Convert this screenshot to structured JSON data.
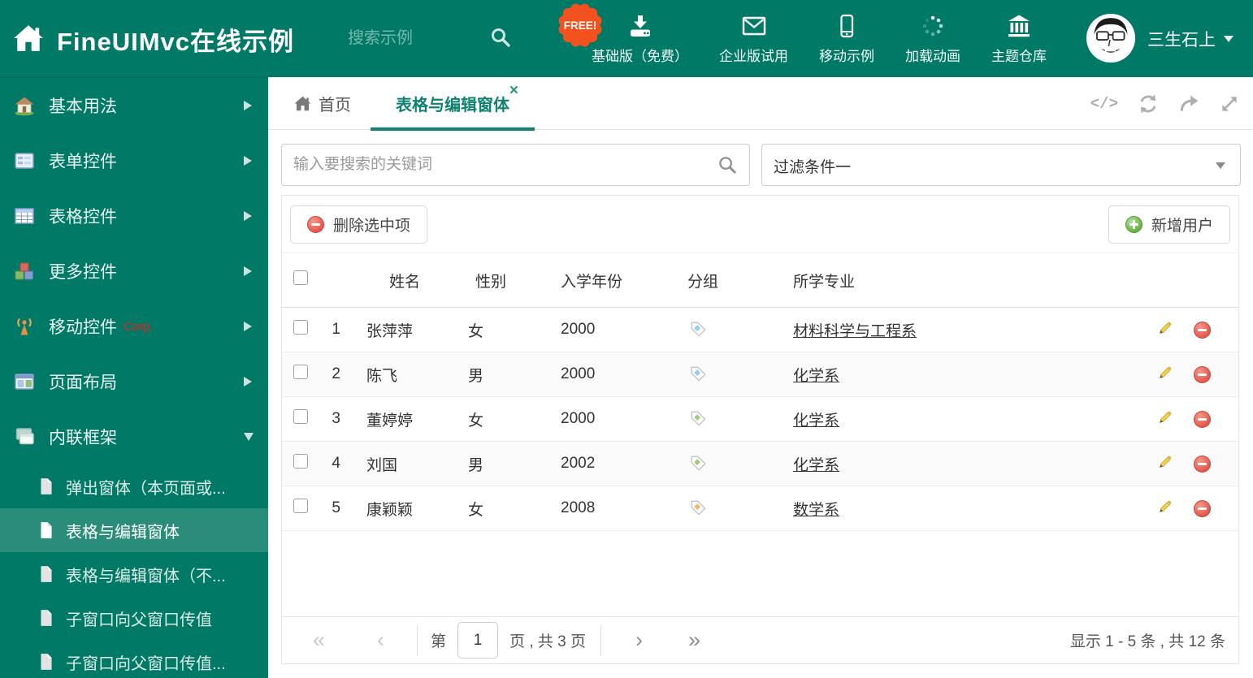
{
  "colors": {
    "brand_teal": "#007a66",
    "sidebar_selected_teal": "#2a8d7a",
    "free_badge_orange": "#f3511d",
    "corp_red": "#f21d1d",
    "active_tab_teal": "#0e8171",
    "tag_blue": "#8ecef2",
    "tag_green": "#9fcc7e",
    "tag_orange": "#f8b26a"
  },
  "header": {
    "title": "FineUIMvc在线示例",
    "search_placeholder": "搜索示例",
    "free_badge": "FREE!",
    "nav": [
      {
        "label": "基础版（免费）",
        "icon": "download-icon"
      },
      {
        "label": "企业版试用",
        "icon": "mail-icon"
      },
      {
        "label": "移动示例",
        "icon": "phone-icon"
      },
      {
        "label": "加载动画",
        "icon": "spinner-icon"
      },
      {
        "label": "主题仓库",
        "icon": "bank-icon"
      }
    ],
    "user": {
      "name": "三生石上"
    }
  },
  "sidebar": {
    "items": [
      {
        "label": "基本用法",
        "icon": "home-icon"
      },
      {
        "label": "表单控件",
        "icon": "form-icon"
      },
      {
        "label": "表格控件",
        "icon": "table-icon"
      },
      {
        "label": "更多控件",
        "icon": "cubes-icon"
      },
      {
        "label": "移动控件",
        "badge": "Corp.",
        "icon": "antenna-icon"
      },
      {
        "label": "页面布局",
        "icon": "layout-icon"
      },
      {
        "label": "内联框架",
        "icon": "frames-icon"
      }
    ],
    "subitems": [
      {
        "label": "弹出窗体（本页面或..."
      },
      {
        "label": "表格与编辑窗体"
      },
      {
        "label": "表格与编辑窗体（不..."
      },
      {
        "label": "子窗口向父窗口传值"
      },
      {
        "label": "子窗口向父窗口传值..."
      }
    ]
  },
  "tabs": {
    "home_label": "首页",
    "active_label": "表格与编辑窗体"
  },
  "filters": {
    "search_placeholder": "输入要搜索的关键词",
    "filter_value": "过滤条件一"
  },
  "toolbar": {
    "delete_label": "删除选中项",
    "add_label": "新增用户"
  },
  "table": {
    "columns": {
      "name": "姓名",
      "gender": "性别",
      "year": "入学年份",
      "group": "分组",
      "major": "所学专业"
    },
    "rows": [
      {
        "num": "1",
        "name": "张萍萍",
        "gender": "女",
        "year": "2000",
        "tag_color": "#8ecef2",
        "major": "材料科学与工程系"
      },
      {
        "num": "2",
        "name": "陈飞",
        "gender": "男",
        "year": "2000",
        "tag_color": "#8ecef2",
        "major": "化学系"
      },
      {
        "num": "3",
        "name": "董婷婷",
        "gender": "女",
        "year": "2000",
        "tag_color": "#9fcc7e",
        "major": "化学系"
      },
      {
        "num": "4",
        "name": "刘国",
        "gender": "男",
        "year": "2002",
        "tag_color": "#9fcc7e",
        "major": "化学系"
      },
      {
        "num": "5",
        "name": "康颖颖",
        "gender": "女",
        "year": "2008",
        "tag_color": "#f8b26a",
        "major": "数学系"
      }
    ]
  },
  "pagination": {
    "page_prefix": "第",
    "page_value": "1",
    "page_suffix": "页 , 共 3 页",
    "summary": "显示 1 - 5 条 , 共 12 条"
  }
}
